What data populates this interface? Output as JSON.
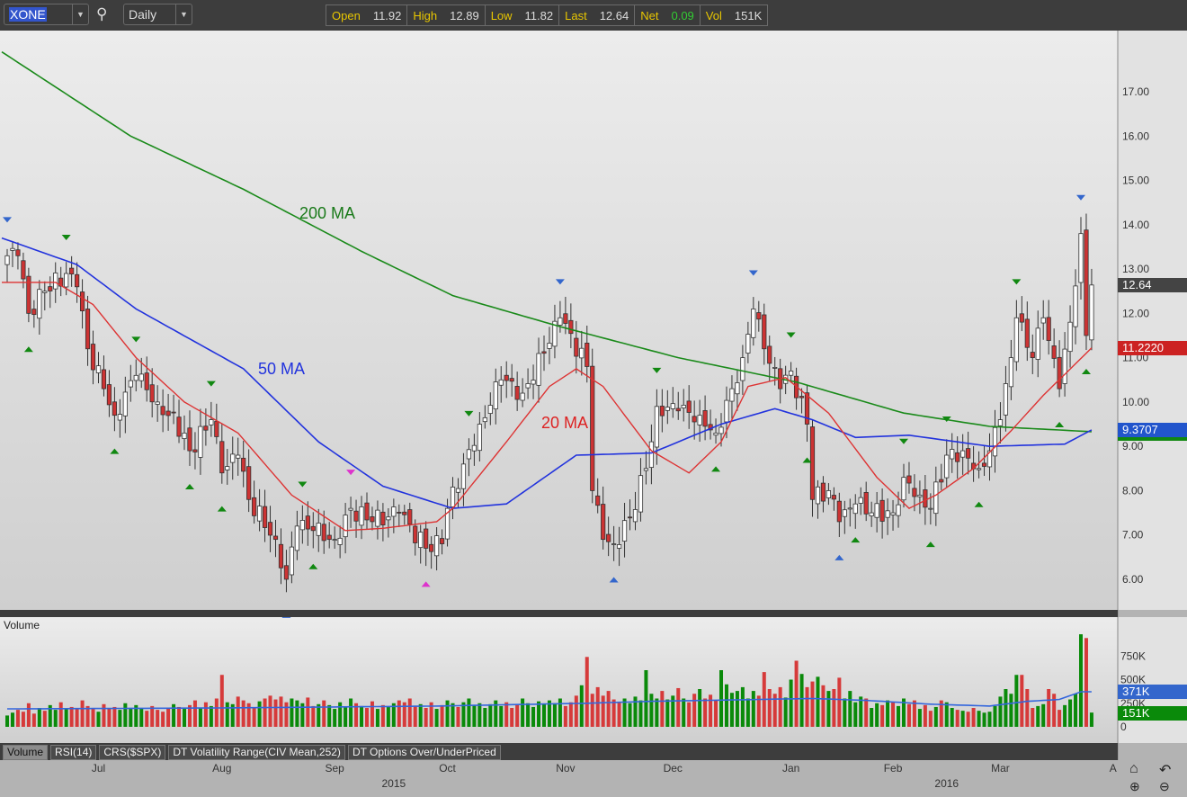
{
  "toolbar": {
    "symbol": "XONE",
    "interval": "Daily",
    "quote": [
      {
        "label": "Open",
        "value": "11.92",
        "color": "#dddddd"
      },
      {
        "label": "High",
        "value": "12.89",
        "color": "#dddddd"
      },
      {
        "label": "Low",
        "value": "11.82",
        "color": "#dddddd"
      },
      {
        "label": "Last",
        "value": "12.64",
        "color": "#dddddd"
      },
      {
        "label": "Net",
        "value": "0.09",
        "color": "#33cc33"
      },
      {
        "label": "Vol",
        "value": "151K",
        "color": "#dddddd"
      }
    ]
  },
  "tabs": [
    "Volume",
    "RSI(14)",
    "CRS($SPX)",
    "DT Volatility Range(CIV Mean,252)",
    "DT Options Over/UnderPriced"
  ],
  "volume_panel_label": "Volume",
  "price_boxes": {
    "last": "12.64",
    "ma20": "11.2220",
    "ma50": "9.3707"
  },
  "volume_boxes": {
    "avg": "371K",
    "last": "151K"
  },
  "annotations": {
    "ma200": "200 MA",
    "ma50": "50 MA",
    "ma20": "20 MA"
  },
  "chart_data": {
    "type": "candlestick",
    "symbol": "XONE",
    "price_ticks": [
      "17.00",
      "16.00",
      "15.00",
      "14.00",
      "13.00",
      "12.00",
      "11.00",
      "10.00",
      "9.00",
      "8.00",
      "7.00",
      "6.00"
    ],
    "ylim": [
      5.72,
      18.3
    ],
    "volume_ticks": [
      "750K",
      "500K",
      "250K",
      "0"
    ],
    "x_ticks": [
      {
        "label": "Jul",
        "day": 17
      },
      {
        "label": "Aug",
        "day": 40
      },
      {
        "label": "Sep",
        "day": 61
      },
      {
        "label": "Oct",
        "day": 82
      },
      {
        "label": "Nov",
        "day": 104
      },
      {
        "label": "Dec",
        "day": 124
      },
      {
        "label": "Jan",
        "day": 146
      },
      {
        "label": "Feb",
        "day": 165
      },
      {
        "label": "Mar",
        "day": 185
      },
      {
        "label": "A",
        "day": 206
      }
    ],
    "year_labels": [
      {
        "label": "2015",
        "day": 72
      },
      {
        "label": "2016",
        "day": 175
      }
    ],
    "close_keypoints": [
      [
        0,
        13.3
      ],
      [
        2,
        13.3
      ],
      [
        4,
        12.0
      ],
      [
        7,
        12.5
      ],
      [
        11,
        12.9
      ],
      [
        13,
        12.6
      ],
      [
        15,
        11.2
      ],
      [
        18,
        10.3
      ],
      [
        20,
        9.7
      ],
      [
        24,
        10.6
      ],
      [
        28,
        10.0
      ],
      [
        33,
        9.3
      ],
      [
        34,
        8.9
      ],
      [
        38,
        9.6
      ],
      [
        40,
        8.4
      ],
      [
        43,
        8.8
      ],
      [
        45,
        7.8
      ],
      [
        50,
        6.9
      ],
      [
        52,
        6.0
      ],
      [
        54,
        7.2
      ],
      [
        57,
        7.1
      ],
      [
        61,
        6.9
      ],
      [
        64,
        7.6
      ],
      [
        68,
        7.3
      ],
      [
        73,
        7.5
      ],
      [
        78,
        6.7
      ],
      [
        81,
        6.8
      ],
      [
        82,
        7.6
      ],
      [
        85,
        8.6
      ],
      [
        88,
        9.5
      ],
      [
        92,
        10.5
      ],
      [
        96,
        10.2
      ],
      [
        100,
        11.1
      ],
      [
        103,
        11.9
      ],
      [
        108,
        10.8
      ],
      [
        109,
        8.0
      ],
      [
        111,
        6.9
      ],
      [
        113,
        6.8
      ],
      [
        116,
        7.4
      ],
      [
        119,
        8.5
      ],
      [
        121,
        9.9
      ],
      [
        125,
        9.8
      ],
      [
        129,
        9.7
      ],
      [
        132,
        9.3
      ],
      [
        135,
        10.3
      ],
      [
        137,
        11.0
      ],
      [
        139,
        12.1
      ],
      [
        141,
        11.2
      ],
      [
        144,
        10.3
      ],
      [
        146,
        10.7
      ],
      [
        149,
        9.5
      ],
      [
        150,
        7.8
      ],
      [
        153,
        8.0
      ],
      [
        155,
        7.3
      ],
      [
        158,
        7.7
      ],
      [
        161,
        7.5
      ],
      [
        165,
        7.5
      ],
      [
        167,
        8.3
      ],
      [
        170,
        7.9
      ],
      [
        172,
        7.6
      ],
      [
        175,
        8.8
      ],
      [
        178,
        8.9
      ],
      [
        181,
        8.5
      ],
      [
        183,
        8.9
      ],
      [
        185,
        9.6
      ],
      [
        187,
        11.0
      ],
      [
        188,
        11.9
      ],
      [
        191,
        11.0
      ],
      [
        193,
        11.9
      ],
      [
        196,
        10.3
      ],
      [
        198,
        11.8
      ],
      [
        200,
        13.8
      ],
      [
        201,
        11.5
      ],
      [
        202,
        12.64
      ]
    ],
    "ma200": [
      [
        -1,
        17.9
      ],
      [
        23,
        16.0
      ],
      [
        44,
        14.8
      ],
      [
        66,
        13.4
      ],
      [
        83,
        12.4
      ],
      [
        103,
        11.7
      ],
      [
        125,
        11.0
      ],
      [
        147,
        10.45
      ],
      [
        167,
        9.75
      ],
      [
        183,
        9.45
      ],
      [
        202,
        9.33
      ]
    ],
    "ma50": [
      [
        -1,
        13.7
      ],
      [
        13,
        13.1
      ],
      [
        24,
        12.1
      ],
      [
        44,
        10.75
      ],
      [
        58,
        9.1
      ],
      [
        70,
        8.1
      ],
      [
        83,
        7.6
      ],
      [
        93,
        7.7
      ],
      [
        106,
        8.8
      ],
      [
        120,
        8.85
      ],
      [
        133,
        9.5
      ],
      [
        143,
        9.85
      ],
      [
        150,
        9.6
      ],
      [
        158,
        9.2
      ],
      [
        168,
        9.25
      ],
      [
        183,
        9.0
      ],
      [
        197,
        9.05
      ],
      [
        202,
        9.37
      ]
    ],
    "ma20": [
      [
        -1,
        12.7
      ],
      [
        9,
        12.7
      ],
      [
        16,
        12.2
      ],
      [
        24,
        11.0
      ],
      [
        33,
        10.0
      ],
      [
        43,
        9.3
      ],
      [
        53,
        7.9
      ],
      [
        63,
        7.1
      ],
      [
        70,
        7.15
      ],
      [
        80,
        7.3
      ],
      [
        83,
        7.6
      ],
      [
        93,
        9.1
      ],
      [
        101,
        10.35
      ],
      [
        106,
        10.75
      ],
      [
        111,
        10.35
      ],
      [
        120,
        8.9
      ],
      [
        127,
        8.4
      ],
      [
        133,
        9.1
      ],
      [
        138,
        10.35
      ],
      [
        145,
        10.55
      ],
      [
        153,
        9.75
      ],
      [
        162,
        8.3
      ],
      [
        168,
        7.6
      ],
      [
        173,
        7.9
      ],
      [
        180,
        8.5
      ],
      [
        187,
        9.35
      ],
      [
        193,
        10.15
      ],
      [
        202,
        11.22
      ]
    ],
    "volume_k": [
      120,
      150,
      180,
      160,
      250,
      140,
      200,
      170,
      230,
      180,
      260,
      190,
      210,
      200,
      280,
      220,
      190,
      160,
      240,
      200,
      210,
      180,
      250,
      190,
      230,
      200,
      170,
      220,
      180,
      160,
      200,
      240,
      210,
      190,
      230,
      280,
      200,
      260,
      220,
      300,
      550,
      260,
      240,
      320,
      280,
      250,
      200,
      270,
      300,
      330,
      290,
      320,
      260,
      300,
      280,
      250,
      310,
      220,
      240,
      280,
      230,
      190,
      260,
      210,
      300,
      250,
      220,
      200,
      270,
      190,
      230,
      210,
      250,
      280,
      260,
      300,
      220,
      240,
      200,
      260,
      190,
      230,
      280,
      250,
      210,
      260,
      300,
      230,
      250,
      200,
      240,
      280,
      220,
      260,
      200,
      230,
      300,
      250,
      210,
      270,
      240,
      280,
      250,
      300,
      220,
      260,
      330,
      440,
      740,
      350,
      420,
      330,
      380,
      290,
      260,
      300,
      250,
      320,
      280,
      600,
      350,
      300,
      380,
      290,
      330,
      410,
      300,
      260,
      350,
      400,
      300,
      340,
      280,
      600,
      450,
      360,
      380,
      420,
      300,
      380,
      330,
      580,
      400,
      350,
      420,
      310,
      500,
      700,
      560,
      420,
      480,
      530,
      440,
      380,
      400,
      520,
      300,
      380,
      260,
      320,
      300,
      200,
      250,
      230,
      280,
      260,
      220,
      300,
      240,
      280,
      190,
      230,
      170,
      210,
      280,
      260,
      200,
      180,
      170,
      160,
      200,
      170,
      150,
      160,
      220,
      320,
      400,
      350,
      550,
      550,
      400,
      200,
      220,
      240,
      400,
      350,
      180,
      230,
      290,
      350,
      980,
      940,
      151
    ],
    "volume_avg_k": [
      [
        0,
        190
      ],
      [
        40,
        200
      ],
      [
        80,
        220
      ],
      [
        108,
        250
      ],
      [
        120,
        270
      ],
      [
        150,
        300
      ],
      [
        160,
        280
      ],
      [
        172,
        240
      ],
      [
        183,
        220
      ],
      [
        190,
        270
      ],
      [
        196,
        290
      ],
      [
        200,
        371
      ],
      [
        202,
        371
      ]
    ],
    "markers": [
      {
        "day": 0,
        "kind": "top",
        "color": "#3366cc"
      },
      {
        "day": 103,
        "kind": "top",
        "color": "#3366cc"
      },
      {
        "day": 139,
        "kind": "top",
        "color": "#3366cc"
      },
      {
        "day": 200,
        "kind": "top",
        "color": "#3366cc"
      },
      {
        "day": 52,
        "kind": "bottom",
        "color": "#3366cc"
      },
      {
        "day": 113,
        "kind": "bottom",
        "color": "#3366cc"
      },
      {
        "day": 155,
        "kind": "bottom",
        "color": "#3366cc"
      },
      {
        "day": 64,
        "kind": "top",
        "color": "#dd33cc"
      },
      {
        "day": 78,
        "kind": "bottom",
        "color": "#dd33cc"
      },
      {
        "day": 4,
        "kind": "bottom",
        "color": "#118811"
      },
      {
        "day": 20,
        "kind": "bottom",
        "color": "#118811"
      },
      {
        "day": 34,
        "kind": "bottom",
        "color": "#118811"
      },
      {
        "day": 40,
        "kind": "bottom",
        "color": "#118811"
      },
      {
        "day": 57,
        "kind": "bottom",
        "color": "#118811"
      },
      {
        "day": 132,
        "kind": "bottom",
        "color": "#118811"
      },
      {
        "day": 149,
        "kind": "bottom",
        "color": "#118811"
      },
      {
        "day": 158,
        "kind": "bottom",
        "color": "#118811"
      },
      {
        "day": 172,
        "kind": "bottom",
        "color": "#118811"
      },
      {
        "day": 181,
        "kind": "bottom",
        "color": "#118811"
      },
      {
        "day": 196,
        "kind": "bottom",
        "color": "#118811"
      },
      {
        "day": 201,
        "kind": "bottom",
        "color": "#118811"
      },
      {
        "day": 11,
        "kind": "top",
        "color": "#118811"
      },
      {
        "day": 24,
        "kind": "top",
        "color": "#118811"
      },
      {
        "day": 38,
        "kind": "top",
        "color": "#118811"
      },
      {
        "day": 55,
        "kind": "top",
        "color": "#118811"
      },
      {
        "day": 86,
        "kind": "top",
        "color": "#118811"
      },
      {
        "day": 121,
        "kind": "top",
        "color": "#118811"
      },
      {
        "day": 146,
        "kind": "top",
        "color": "#118811"
      },
      {
        "day": 167,
        "kind": "top",
        "color": "#118811"
      },
      {
        "day": 175,
        "kind": "top",
        "color": "#118811"
      },
      {
        "day": 188,
        "kind": "top",
        "color": "#118811"
      }
    ],
    "colors": {
      "up": "#ffffff",
      "down": "#cc3333",
      "vol_up": "#0a8a0a",
      "vol_down": "#d63a3a",
      "ma200": "#1a8a1a",
      "ma50": "#2233dd",
      "ma20": "#dd3333",
      "vol_avg": "#3366dd"
    }
  }
}
